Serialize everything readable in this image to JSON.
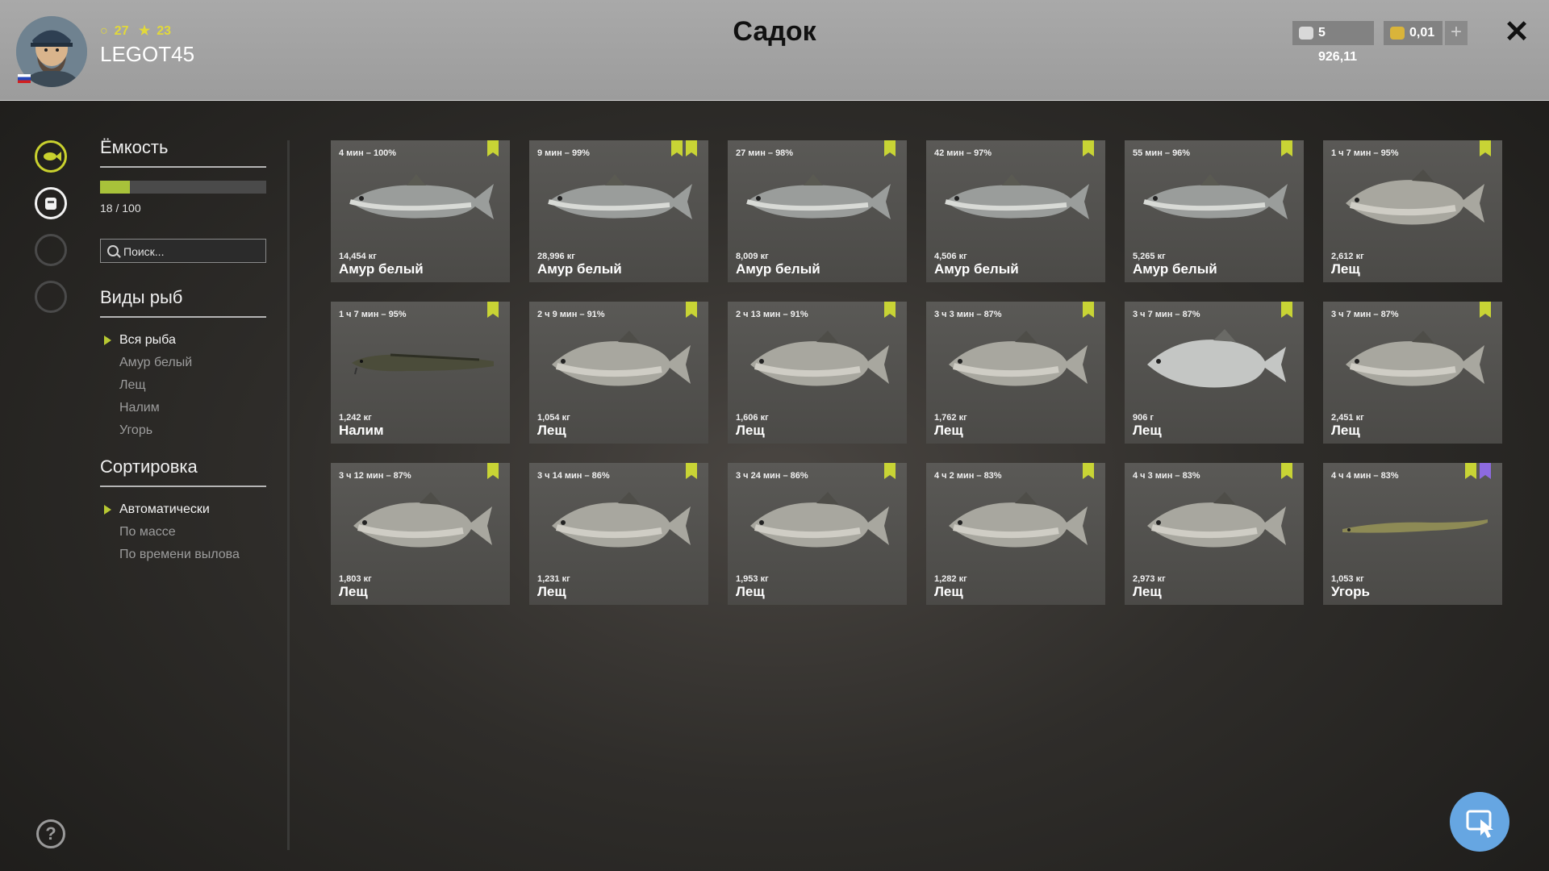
{
  "header": {
    "title": "Садок",
    "stats": {
      "level": "27",
      "rank": "23"
    },
    "username": "LEGOT45",
    "silver": "5 926,11",
    "gold": "0,01",
    "add_label": "+",
    "close_label": "✕"
  },
  "sidebar": {
    "capacity_title": "Ёмкость",
    "capacity_fill": 0.18,
    "capacity_text": "18 / 100",
    "search_placeholder": "Поиск...",
    "species_title": "Виды рыб",
    "species": [
      "Вся рыба",
      "Амур белый",
      "Лещ",
      "Налим",
      "Угорь"
    ],
    "sort_title": "Сортировка",
    "sort": [
      "Автоматически",
      "По массе",
      "По времени вылова"
    ],
    "help_label": "?"
  },
  "fish": [
    {
      "time": "4 мин – 100%",
      "weight": "14,454 кг",
      "name": "Амур белый",
      "kind": "amur",
      "marks": [
        "green"
      ]
    },
    {
      "time": "9 мин – 99%",
      "weight": "28,996 кг",
      "name": "Амур белый",
      "kind": "amur",
      "marks": [
        "green",
        "star"
      ]
    },
    {
      "time": "27 мин – 98%",
      "weight": "8,009 кг",
      "name": "Амур белый",
      "kind": "amur",
      "marks": [
        "green"
      ]
    },
    {
      "time": "42 мин – 97%",
      "weight": "4,506 кг",
      "name": "Амур белый",
      "kind": "amur",
      "marks": [
        "green"
      ]
    },
    {
      "time": "55 мин – 96%",
      "weight": "5,265 кг",
      "name": "Амур белый",
      "kind": "amur",
      "marks": [
        "green"
      ]
    },
    {
      "time": "1 ч 7 мин – 95%",
      "weight": "2,612 кг",
      "name": "Лещ",
      "kind": "bream",
      "marks": [
        "green"
      ]
    },
    {
      "time": "1 ч 7 мин – 95%",
      "weight": "1,242 кг",
      "name": "Налим",
      "kind": "burbot",
      "marks": [
        "green"
      ]
    },
    {
      "time": "2 ч 9 мин – 91%",
      "weight": "1,054 кг",
      "name": "Лещ",
      "kind": "bream",
      "marks": [
        "green"
      ]
    },
    {
      "time": "2 ч 13 мин – 91%",
      "weight": "1,606 кг",
      "name": "Лещ",
      "kind": "bream",
      "marks": [
        "green"
      ]
    },
    {
      "time": "3 ч 3 мин – 87%",
      "weight": "1,762 кг",
      "name": "Лещ",
      "kind": "bream",
      "marks": [
        "green"
      ]
    },
    {
      "time": "3 ч 7 мин – 87%",
      "weight": "906 г",
      "name": "Лещ",
      "kind": "bream-silver",
      "marks": [
        "green"
      ]
    },
    {
      "time": "3 ч 7 мин – 87%",
      "weight": "2,451 кг",
      "name": "Лещ",
      "kind": "bream",
      "marks": [
        "green"
      ]
    },
    {
      "time": "3 ч 12 мин – 87%",
      "weight": "1,803 кг",
      "name": "Лещ",
      "kind": "bream",
      "marks": [
        "green"
      ]
    },
    {
      "time": "3 ч 14 мин – 86%",
      "weight": "1,231 кг",
      "name": "Лещ",
      "kind": "bream",
      "marks": [
        "green"
      ]
    },
    {
      "time": "3 ч 24 мин – 86%",
      "weight": "1,953 кг",
      "name": "Лещ",
      "kind": "bream",
      "marks": [
        "green"
      ]
    },
    {
      "time": "4 ч 2 мин – 83%",
      "weight": "1,282 кг",
      "name": "Лещ",
      "kind": "bream",
      "marks": [
        "green"
      ]
    },
    {
      "time": "4 ч 3 мин – 83%",
      "weight": "2,973 кг",
      "name": "Лещ",
      "kind": "bream",
      "marks": [
        "green"
      ]
    },
    {
      "time": "4 ч 4 мин – 83%",
      "weight": "1,053 кг",
      "name": "Угорь",
      "kind": "eel",
      "marks": [
        "green",
        "purple"
      ]
    }
  ],
  "colors": {
    "accent": "#c8d435",
    "purple_mark": "#8d6ae0",
    "header_bg": "#a3a3a3"
  }
}
